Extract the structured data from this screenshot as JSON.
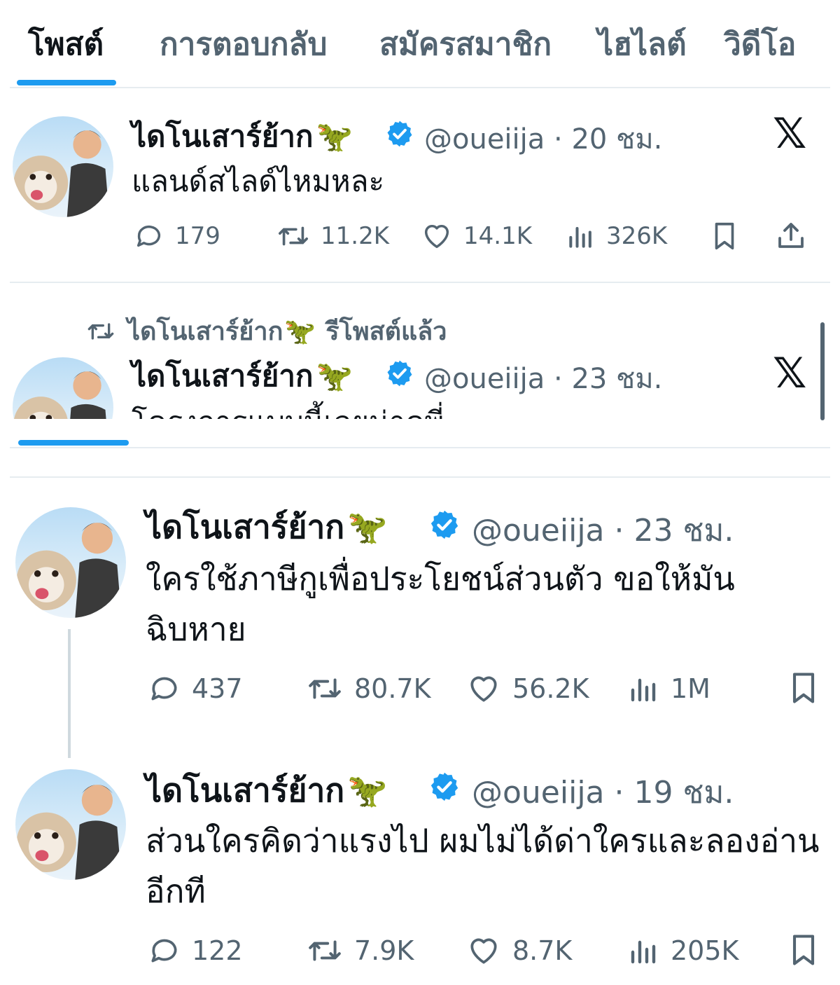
{
  "tabs": [
    {
      "label": "โพสต์",
      "active": true
    },
    {
      "label": "การตอบกลับ",
      "active": false
    },
    {
      "label": "สมัครสมาชิก",
      "active": false
    },
    {
      "label": "ไฮไลต์",
      "active": false
    },
    {
      "label": "วิดีโอ",
      "active": false
    }
  ],
  "user": {
    "display_name": "ไดโนเสาร์ย้าก",
    "emoji": "🦖",
    "handle": "@oueiija"
  },
  "posts": [
    {
      "time": "20 ชม.",
      "text": "แลนด์สไลด์ไหมหละ",
      "replies": "179",
      "reposts": "11.2K",
      "likes": "14.1K",
      "views": "326K"
    },
    {
      "repost_label": "รีโพสต์แล้ว",
      "time": "23 ชม.",
      "text": "โครงการแบบนี้เลยน่าดูพี่"
    },
    {
      "time": "23 ชม.",
      "text": "ใครใช้ภาษีกูเพื่อประโยชน์ส่วนตัว ขอให้มันฉิบหาย",
      "replies": "437",
      "reposts": "80.7K",
      "likes": "56.2K",
      "views": "1M"
    },
    {
      "time": "19 ชม.",
      "text": "ส่วนใครคิดว่าแรงไป ผมไม่ได้ด่าใครและลองอ่านอีกที",
      "replies": "122",
      "reposts": "7.9K",
      "likes": "8.7K",
      "views": "205K"
    }
  ],
  "colors": {
    "accent": "#1d9bf0",
    "text": "#0f1419",
    "muted": "#536471"
  },
  "icons": [
    "reply-icon",
    "repost-icon",
    "like-icon",
    "views-icon",
    "bookmark-icon",
    "share-icon",
    "verified-icon",
    "x-logo-icon"
  ]
}
